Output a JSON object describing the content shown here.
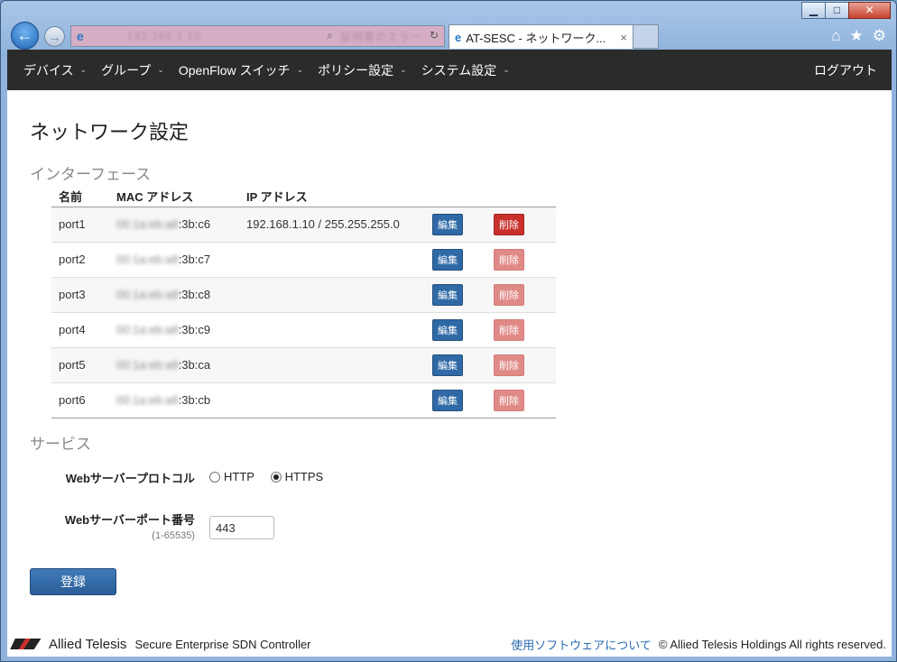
{
  "window": {
    "buttons": {
      "min": "▁",
      "max": "□",
      "close": "✕"
    }
  },
  "browser": {
    "back_icon": "back-arrow-icon",
    "forward_icon": "forward-arrow-icon",
    "address_blur": "192.168.1.10",
    "address_extra": "証明書のエラー",
    "search_glyph": "⌕",
    "refresh_glyph": "↻",
    "tab_title": "AT-SESC - ネットワーク...",
    "tab_close": "×",
    "home_glyph": "⌂",
    "fav_glyph": "★",
    "settings_glyph": "⚙"
  },
  "nav": {
    "menus": [
      "デバイス",
      "グループ",
      "OpenFlow スイッチ",
      "ポリシー設定",
      "システム設定"
    ],
    "caret": "⌄",
    "logout": "ログアウト"
  },
  "page": {
    "title": "ネットワーク設定",
    "interfaces_heading": "インターフェース",
    "services_heading": "サービス"
  },
  "table": {
    "headers": {
      "name": "名前",
      "mac": "MAC アドレス",
      "ip": "IP アドレス"
    },
    "edit_label": "編集",
    "delete_label": "削除",
    "rows": [
      {
        "name": "port1",
        "mac_blur": "00:1a:eb:a8",
        "mac_tail": ":3b:c6",
        "ip": "192.168.1.10 / 255.255.255.0",
        "delete_enabled": true
      },
      {
        "name": "port2",
        "mac_blur": "00:1a:eb:a8",
        "mac_tail": ":3b:c7",
        "ip": "",
        "delete_enabled": false
      },
      {
        "name": "port3",
        "mac_blur": "00:1a:eb:a8",
        "mac_tail": ":3b:c8",
        "ip": "",
        "delete_enabled": false
      },
      {
        "name": "port4",
        "mac_blur": "00:1a:eb:a8",
        "mac_tail": ":3b:c9",
        "ip": "",
        "delete_enabled": false
      },
      {
        "name": "port5",
        "mac_blur": "00:1a:eb:a8",
        "mac_tail": ":3b:ca",
        "ip": "",
        "delete_enabled": false
      },
      {
        "name": "port6",
        "mac_blur": "00:1a:eb:a8",
        "mac_tail": ":3b:cb",
        "ip": "",
        "delete_enabled": false
      }
    ]
  },
  "services": {
    "protocol_label": "Webサーバープロトコル",
    "protocol_options": [
      "HTTP",
      "HTTPS"
    ],
    "protocol_selected": "HTTPS",
    "port_label": "Webサーバーポート番号",
    "port_range": "(1-65535)",
    "port_value": "443"
  },
  "submit_label": "登録",
  "footer": {
    "brand": "Allied Telesis",
    "product": "Secure Enterprise SDN Controller",
    "software_link": "使用ソフトウェアについて",
    "copyright": "© Allied Telesis Holdings All rights reserved."
  },
  "colors": {
    "nav_bg": "#2b2b2b",
    "edit_btn": "#2f6aa6",
    "delete_btn": "#c9302c",
    "delete_disabled": "#e08a87",
    "link": "#2a6ab0"
  }
}
